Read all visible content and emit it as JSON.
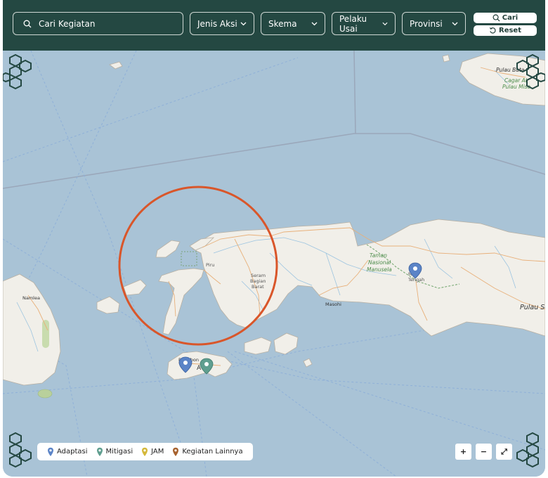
{
  "filters": {
    "search_placeholder": "Cari Kegiatan",
    "jenis_aksi": "Jenis Aksi",
    "skema": "Skema",
    "pelaku_usaha": "Pelaku Usai",
    "provinsi": "Provinsi"
  },
  "actions": {
    "search_label": "Cari",
    "reset_label": "Reset"
  },
  "map": {
    "labels": {
      "piru": "Piru",
      "seram_1": "Seram",
      "seram_2": "Bagian",
      "seram_3": "Barat",
      "masohi": "Masohi",
      "taman_1": "Taman",
      "taman_2": "Nasional",
      "taman_3": "Manusela",
      "maluku_tengah_1": "M    u",
      "maluku_tengah_2": "Tengah",
      "pulau_seram": "Pulau Se",
      "pulau_batanta": "Pulau Bata",
      "cagar_1": "Cagar Al",
      "cagar_2": "Pulau Miso",
      "namlea": "Namlea",
      "ambon_1": "P    Ambon",
      "ambon_2": "A    on"
    },
    "highlight_color": "#d9562a",
    "water_color": "#a9c3d6",
    "land_color": "#f1efe9",
    "road_color": "#e8b07a",
    "river_color": "#9cc4e0"
  },
  "legend": {
    "items": [
      {
        "label": "Adaptasi",
        "color": "#5b84c7",
        "icon": "map-pin-icon"
      },
      {
        "label": "Mitigasi",
        "color": "#5f9e8f",
        "icon": "map-pin-icon"
      },
      {
        "label": "JAM",
        "color": "#d4b83a",
        "icon": "map-pin-icon"
      },
      {
        "label": "Kegiatan Lainnya",
        "color": "#a7622e",
        "icon": "map-pin-icon"
      }
    ]
  },
  "zoom": {
    "in": "+",
    "out": "−",
    "fullscreen": "⤢"
  }
}
